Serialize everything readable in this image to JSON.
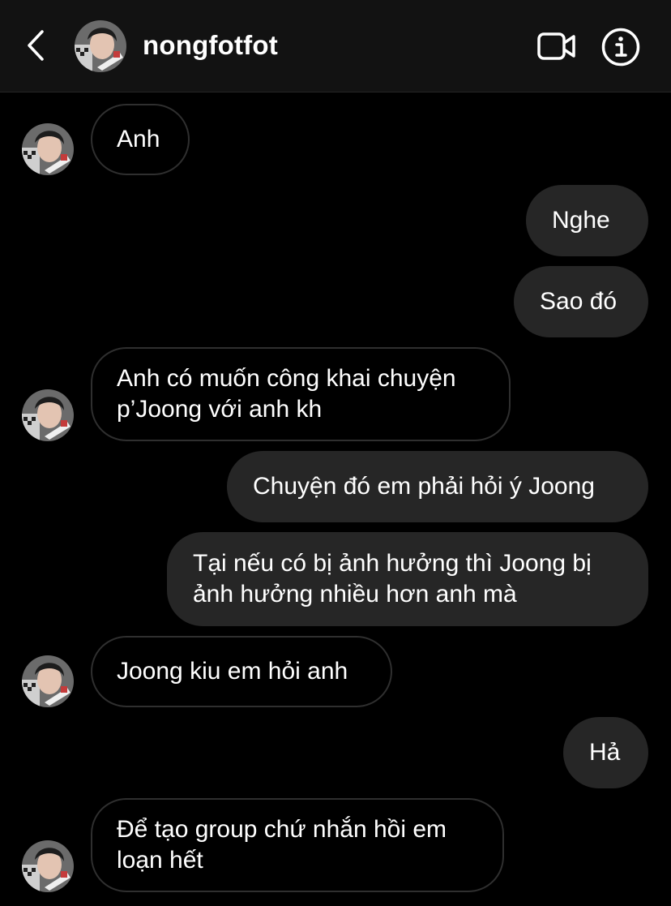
{
  "header": {
    "username": "nongfotfot",
    "back_icon": "chevron-left-icon",
    "video_icon": "video-camera-icon",
    "info_icon": "info-icon"
  },
  "colors": {
    "background": "#000000",
    "header_background": "#121212",
    "outgoing_bubble": "#262626",
    "incoming_border": "#2f2f2f",
    "text": "#ffffff"
  },
  "messages": [
    {
      "direction": "incoming",
      "text": "Anh"
    },
    {
      "direction": "outgoing",
      "text": "Nghe"
    },
    {
      "direction": "outgoing",
      "text": "Sao đó"
    },
    {
      "direction": "incoming",
      "text": "Anh có muốn công khai chuyện\np’Joong với anh kh"
    },
    {
      "direction": "outgoing",
      "text": "Chuyện đó em phải hỏi ý Joong"
    },
    {
      "direction": "outgoing",
      "text": "Tại nếu có bị ảnh hưởng thì Joong bị\nảnh hưởng nhiều hơn anh mà"
    },
    {
      "direction": "incoming",
      "text": "Joong kiu em hỏi anh"
    },
    {
      "direction": "outgoing",
      "text": "Hả"
    },
    {
      "direction": "incoming",
      "text": "Để tạo group chứ nhắn hồi em\nloạn hết"
    }
  ]
}
